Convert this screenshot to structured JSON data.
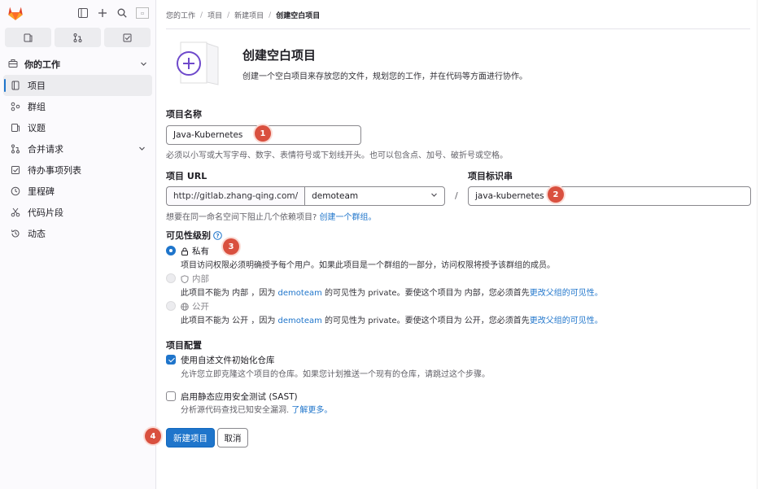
{
  "sidebar": {
    "context_title": "你的工作",
    "items": [
      {
        "label": "项目",
        "icon": "project-icon",
        "active": true
      },
      {
        "label": "群组",
        "icon": "group-icon"
      },
      {
        "label": "议题",
        "icon": "issues-icon"
      },
      {
        "label": "合并请求",
        "icon": "merge-request-icon",
        "expandable": true
      },
      {
        "label": "待办事项列表",
        "icon": "todo-icon"
      },
      {
        "label": "里程碑",
        "icon": "milestone-icon"
      },
      {
        "label": "代码片段",
        "icon": "snippet-icon"
      },
      {
        "label": "动态",
        "icon": "activity-icon"
      }
    ]
  },
  "breadcrumb": [
    "您的工作",
    "项目",
    "新建项目",
    "创建空白项目"
  ],
  "header": {
    "title": "创建空白项目",
    "subtitle": "创建一个空白项目来存放您的文件，规划您的工作，并在代码等方面进行协作。"
  },
  "form": {
    "project_name_label": "项目名称",
    "project_name_value": "Java-Kubernetes",
    "project_name_help": "必须以小写或大写字母、数字、表情符号或下划线开头。也可以包含点、加号、破折号或空格。",
    "project_url_label": "项目 URL",
    "url_prefix": "http://gitlab.zhang-qing.com/",
    "namespace": "demoteam",
    "slash": "/",
    "slug_label": "项目标识串",
    "slug_value": "java-kubernetes",
    "group_help_prefix": "想要在同一命名空间下阻止几个依赖项目?",
    "group_help_link": "创建一个群组。",
    "visibility_label": "可见性级别",
    "visibility_options": [
      {
        "label": "私有",
        "help_prefix": "项目访问权限必须明确授予每个用户。如果此项目是一个群组的一部分，访问权限将授予该群组的成员。",
        "help_ns": "",
        "help_suffix": "",
        "help_link": ""
      },
      {
        "label": "内部",
        "help_prefix": "此项目不能为 内部 ，因为 ",
        "help_ns": "demoteam",
        "help_suffix": " 的可见性为 private。要使这个项目为 内部，您必须首先",
        "help_link": "更改父组的可见性。"
      },
      {
        "label": "公开",
        "help_prefix": "此项目不能为 公开 ，因为 ",
        "help_ns": "demoteam",
        "help_suffix": " 的可见性为 private。要使这个项目为 公开，您必须首先",
        "help_link": "更改父组的可见性。"
      }
    ],
    "config_label": "项目配置",
    "init_readme_label": "使用自述文件初始化仓库",
    "init_readme_help": "允许您立即克隆这个项目的仓库。如果您计划推送一个现有的仓库，请跳过这个步骤。",
    "sast_label": "启用静态应用安全测试 (SAST)",
    "sast_help_prefix": "分析源代码查找已知安全漏洞.",
    "sast_help_link": "了解更多。",
    "create_button": "新建项目",
    "cancel_button": "取消"
  },
  "annotations": [
    "1",
    "2",
    "3",
    "4"
  ],
  "colors": {
    "primary": "#1f75cb",
    "badge": "#d9503f",
    "hero": "#6e49cb"
  }
}
